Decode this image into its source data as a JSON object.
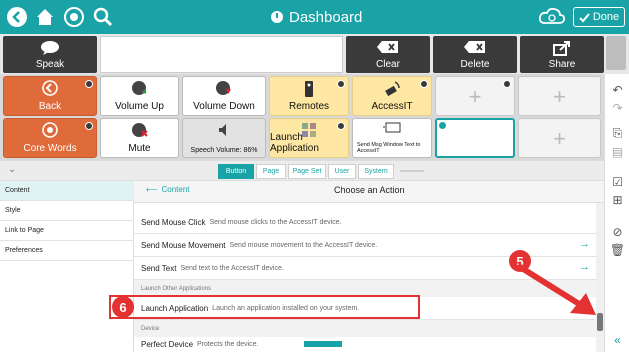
{
  "header": {
    "title": "Dashboard",
    "done_label": "Done"
  },
  "toolbar": {
    "speak_label": "Speak",
    "clear_label": "Clear",
    "delete_label": "Delete",
    "share_label": "Share"
  },
  "grid": {
    "row1": [
      {
        "label": "Back",
        "color": "orange"
      },
      {
        "label": "Volume Up",
        "color": "white"
      },
      {
        "label": "Volume Down",
        "color": "white"
      },
      {
        "label": "Remotes",
        "color": "yellow"
      },
      {
        "label": "AccessIT",
        "color": "yellow"
      },
      {
        "label": "",
        "color": "empty"
      },
      {
        "label": "",
        "color": "empty"
      }
    ],
    "row2": [
      {
        "label": "Core Words",
        "color": "orange"
      },
      {
        "label": "Mute",
        "color": "white"
      },
      {
        "label": "Speech Volume: 86%",
        "color": "gray"
      },
      {
        "label": "Launch Application",
        "color": "yellow"
      },
      {
        "label": "Send Msg Window Text to AccessIT",
        "color": "white"
      },
      {
        "label": "",
        "color": "selected"
      },
      {
        "label": "",
        "color": "empty"
      }
    ]
  },
  "tabs": [
    "Button",
    "Page",
    "Page Set",
    "User",
    "System"
  ],
  "leftnav": [
    "Content",
    "Style",
    "Link to Page",
    "Preferences"
  ],
  "panel": {
    "back_label": "Content",
    "title": "Choose an Action"
  },
  "list": {
    "rows": [
      {
        "name": "Send Mouse Click",
        "desc": "Send mouse clicks to the AccessIT device."
      },
      {
        "name": "Send Mouse Movement",
        "desc": "Send mouse movement to the AccessIT device."
      },
      {
        "name": "Send Text",
        "desc": "Send text to the AccessIT device."
      },
      {
        "name": "Launch Application",
        "desc": "Launch an application installed on your system."
      },
      {
        "name": "Perfect Device",
        "desc": "Protects the device."
      }
    ],
    "section_launch": "Launch Other Applications",
    "section_device": "Device"
  },
  "annotations": {
    "step5": "5",
    "step6": "6"
  },
  "colors": {
    "accent": "#1aa3a6",
    "orange": "#e06b3a",
    "yellow": "#fde7a3",
    "annotation": "#e43131"
  }
}
